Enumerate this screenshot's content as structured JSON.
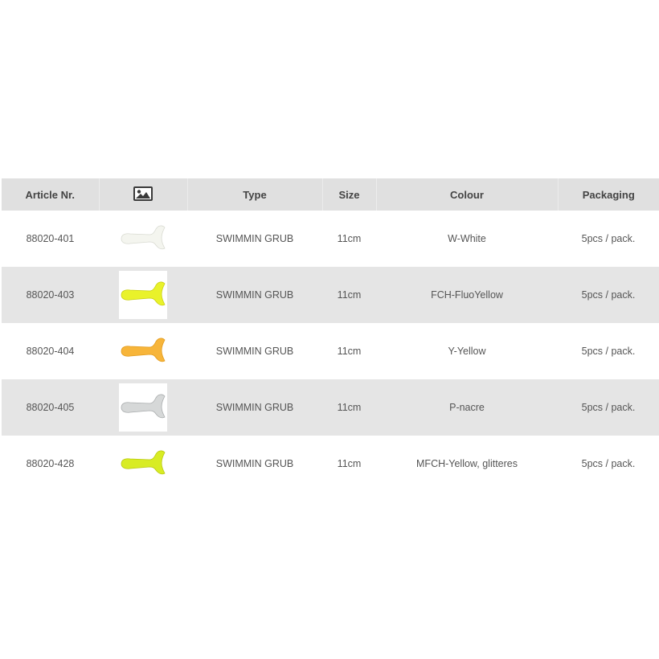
{
  "table": {
    "headers": {
      "article": "Article Nr.",
      "image_icon": "image-icon",
      "type": "Type",
      "size": "Size",
      "colour": "Colour",
      "packaging": "Packaging"
    },
    "rows": [
      {
        "article": "88020-401",
        "type": "SWIMMIN GRUB",
        "size": "11cm",
        "colour": "W-White",
        "packaging": "5pcs / pack.",
        "lure_color": "#f4f5ef",
        "lure_outline": "#d9dbd2"
      },
      {
        "article": "88020-403",
        "type": "SWIMMIN GRUB",
        "size": "11cm",
        "colour": "FCH-FluoYellow",
        "packaging": "5pcs / pack.",
        "lure_color": "#e9f22a",
        "lure_outline": "#c9d010"
      },
      {
        "article": "88020-404",
        "type": "SWIMMIN GRUB",
        "size": "11cm",
        "colour": "Y-Yellow",
        "packaging": "5pcs / pack.",
        "lure_color": "#f7b53a",
        "lure_outline": "#e29a1a"
      },
      {
        "article": "88020-405",
        "type": "SWIMMIN GRUB",
        "size": "11cm",
        "colour": "P-nacre",
        "packaging": "5pcs / pack.",
        "lure_color": "#d6d8d8",
        "lure_outline": "#a9acad"
      },
      {
        "article": "88020-428",
        "type": "SWIMMIN GRUB",
        "size": "11cm",
        "colour": "MFCH-Yellow, glitteres",
        "packaging": "5pcs / pack.",
        "lure_color": "#d8ec24",
        "lure_outline": "#b8c812"
      }
    ]
  }
}
